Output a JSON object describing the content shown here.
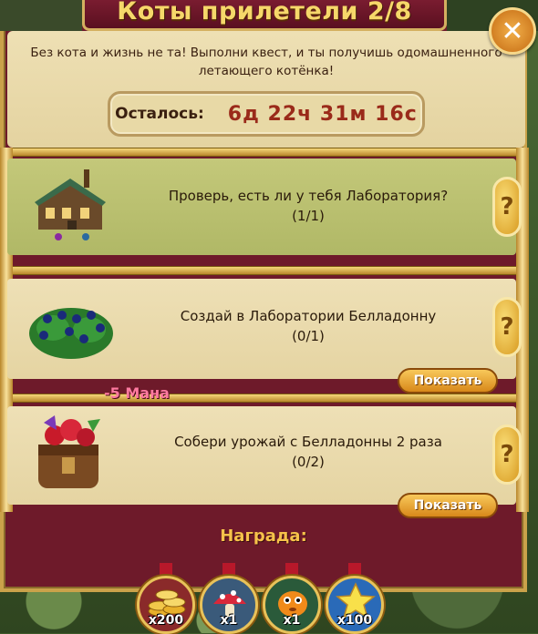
{
  "window": {
    "title": "Коты прилетели 2/8",
    "intro_line1": "Без кота и жизнь не та! Выполни квест, и ты получишь одомашненного",
    "intro_line2": "летающего котёнка!",
    "timer_label": "Осталось:",
    "timer_value": "6д 22ч 31м 16с"
  },
  "tasks": [
    {
      "title": "Проверь, есть ли у тебя Лаборатория?",
      "progress": "(1/1)",
      "icon": "laboratory-building-icon",
      "completed": true
    },
    {
      "title": "Создай в Лаборатории Белладонну",
      "progress": "(0/1)",
      "icon": "belladonna-bush-icon",
      "button": "Показать"
    },
    {
      "title": "Собери урожай с Белладонны 2 раза",
      "progress": "(0/2)",
      "icon": "harvest-bag-icon",
      "button": "Показать"
    }
  ],
  "floating": {
    "mana": "-5 Мана"
  },
  "rewards": {
    "label": "Награда:",
    "items": [
      {
        "icon": "gold-coins-icon",
        "qty": "x200"
      },
      {
        "icon": "mushroom-icon",
        "qty": "x1"
      },
      {
        "icon": "orange-creature-icon",
        "qty": "x1"
      },
      {
        "icon": "star-icon",
        "qty": "x100"
      }
    ]
  },
  "help_symbol": "?",
  "close_symbol": "✕",
  "colors": {
    "frame": "#6e1a2a",
    "gold": "#caa24a",
    "completed_task": "#bcc270",
    "title": "#f6d86a"
  }
}
